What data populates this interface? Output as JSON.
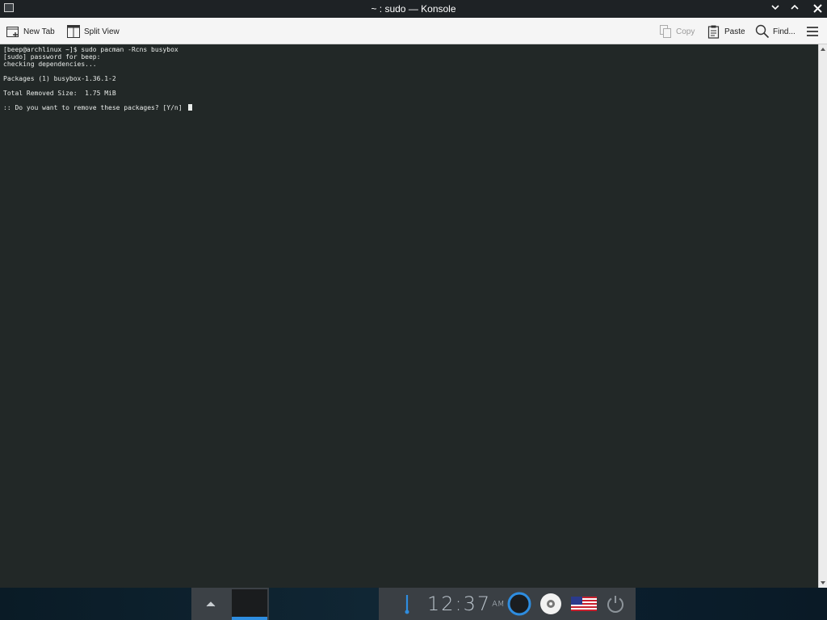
{
  "window": {
    "title": "~ : sudo — Konsole",
    "controls": [
      "minimize-icon",
      "maximize-icon",
      "close-icon"
    ]
  },
  "toolbar": {
    "new_tab_label": "New Tab",
    "split_view_label": "Split View",
    "copy_label": "Copy",
    "paste_label": "Paste",
    "find_label": "Find...",
    "menu_icon": "hamburger-menu-icon"
  },
  "terminal": {
    "lines": [
      "[beep@archlinux ~]$ sudo pacman -Rcns busybox",
      "[sudo] password for beep:",
      "checking dependencies...",
      "",
      "Packages (1) busybox-1.36.1-2",
      "",
      "Total Removed Size:  1.75 MiB",
      "",
      ":: Do you want to remove these packages? [Y/n] "
    ],
    "background": "#222827",
    "foreground": "#e9ecea"
  },
  "taskbar": {
    "clock_time": "12:37",
    "clock_ampm": "AM",
    "accent": "#2e8de0",
    "tray_icons": [
      "thermometer-icon",
      "network-ring-icon",
      "disc-icon",
      "us-flag-icon",
      "power-icon"
    ]
  }
}
